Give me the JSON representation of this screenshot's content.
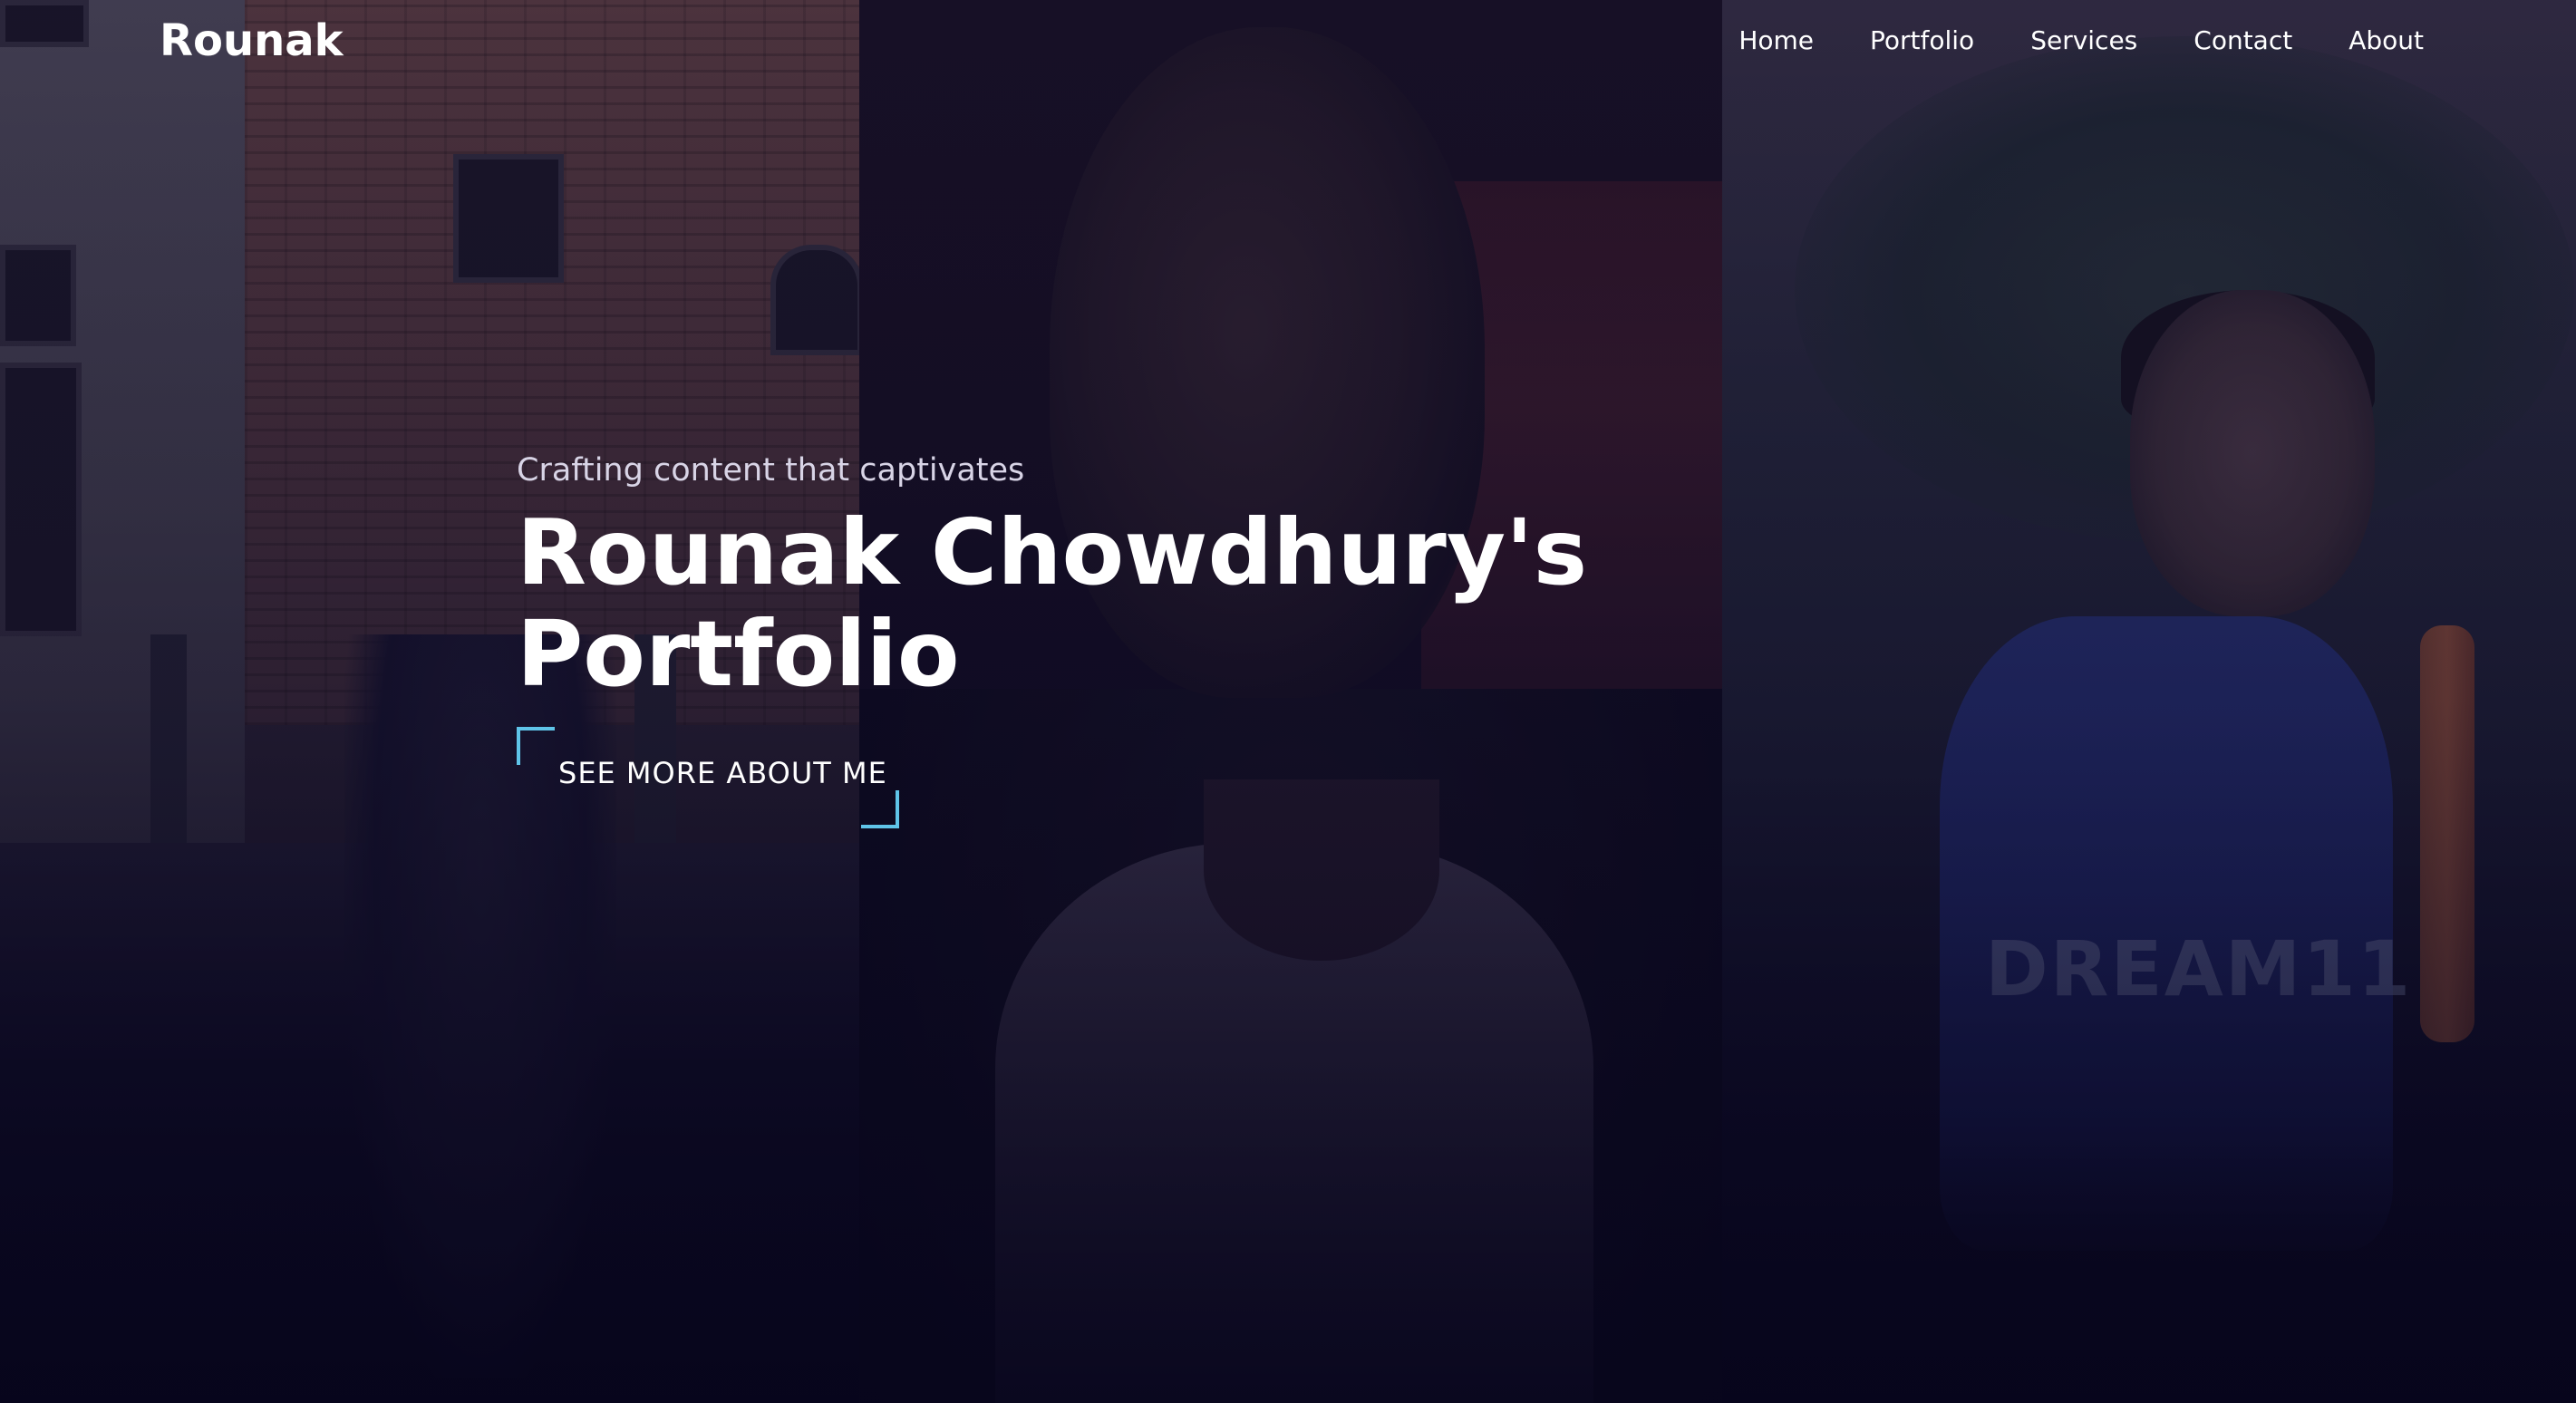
{
  "brand": "Rounak",
  "nav": {
    "items": [
      "Home",
      "Portfolio",
      "Services",
      "Contact",
      "About"
    ]
  },
  "hero": {
    "tagline": "Crafting content that captivates",
    "title_line1": "Rounak Chowdhury's",
    "title_line2": "Portfolio",
    "cta_label": "SEE MORE ABOUT ME"
  },
  "photo_text": {
    "jersey": "DREAM11"
  },
  "colors": {
    "background": "#07051c",
    "accent": "#5fc4e8",
    "text": "#ffffff",
    "tagline": "#d8d4e6"
  }
}
